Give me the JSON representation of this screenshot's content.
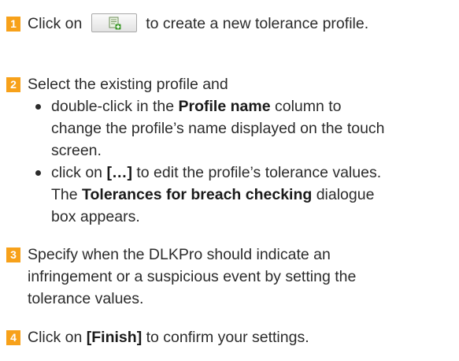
{
  "steps": [
    {
      "number": "1",
      "before_icon": "Click on",
      "icon": "new-profile-icon",
      "after_icon": "to create a new tolerance profile."
    },
    {
      "number": "2",
      "intro": "Select the existing profile and",
      "bullets": [
        {
          "pre": "double-click in the",
          "bold": "Profile name",
          "post_line1": "column to",
          "line2": "change the profile’s name displayed on the touch",
          "line3": "screen."
        },
        {
          "pre": "click on",
          "bold": "[…]",
          "post_line1": "to edit the profile’s tolerance values.",
          "line2_bold": "The",
          "line2_strong": "Tolerances for breach checking",
          "line2_post": "dialogue",
          "line3": "box appears."
        }
      ]
    },
    {
      "number": "3",
      "lines": [
        "Specify when the DLKPro should indicate an",
        "infringement or a suspicious event by setting the",
        "tolerance values."
      ]
    },
    {
      "number": "4",
      "pre": "Click on",
      "bold": "[Finish]",
      "post": "to confirm your settings."
    }
  ],
  "colors": {
    "step_badge": "#f7a11a",
    "text": "#2b2b2b"
  }
}
